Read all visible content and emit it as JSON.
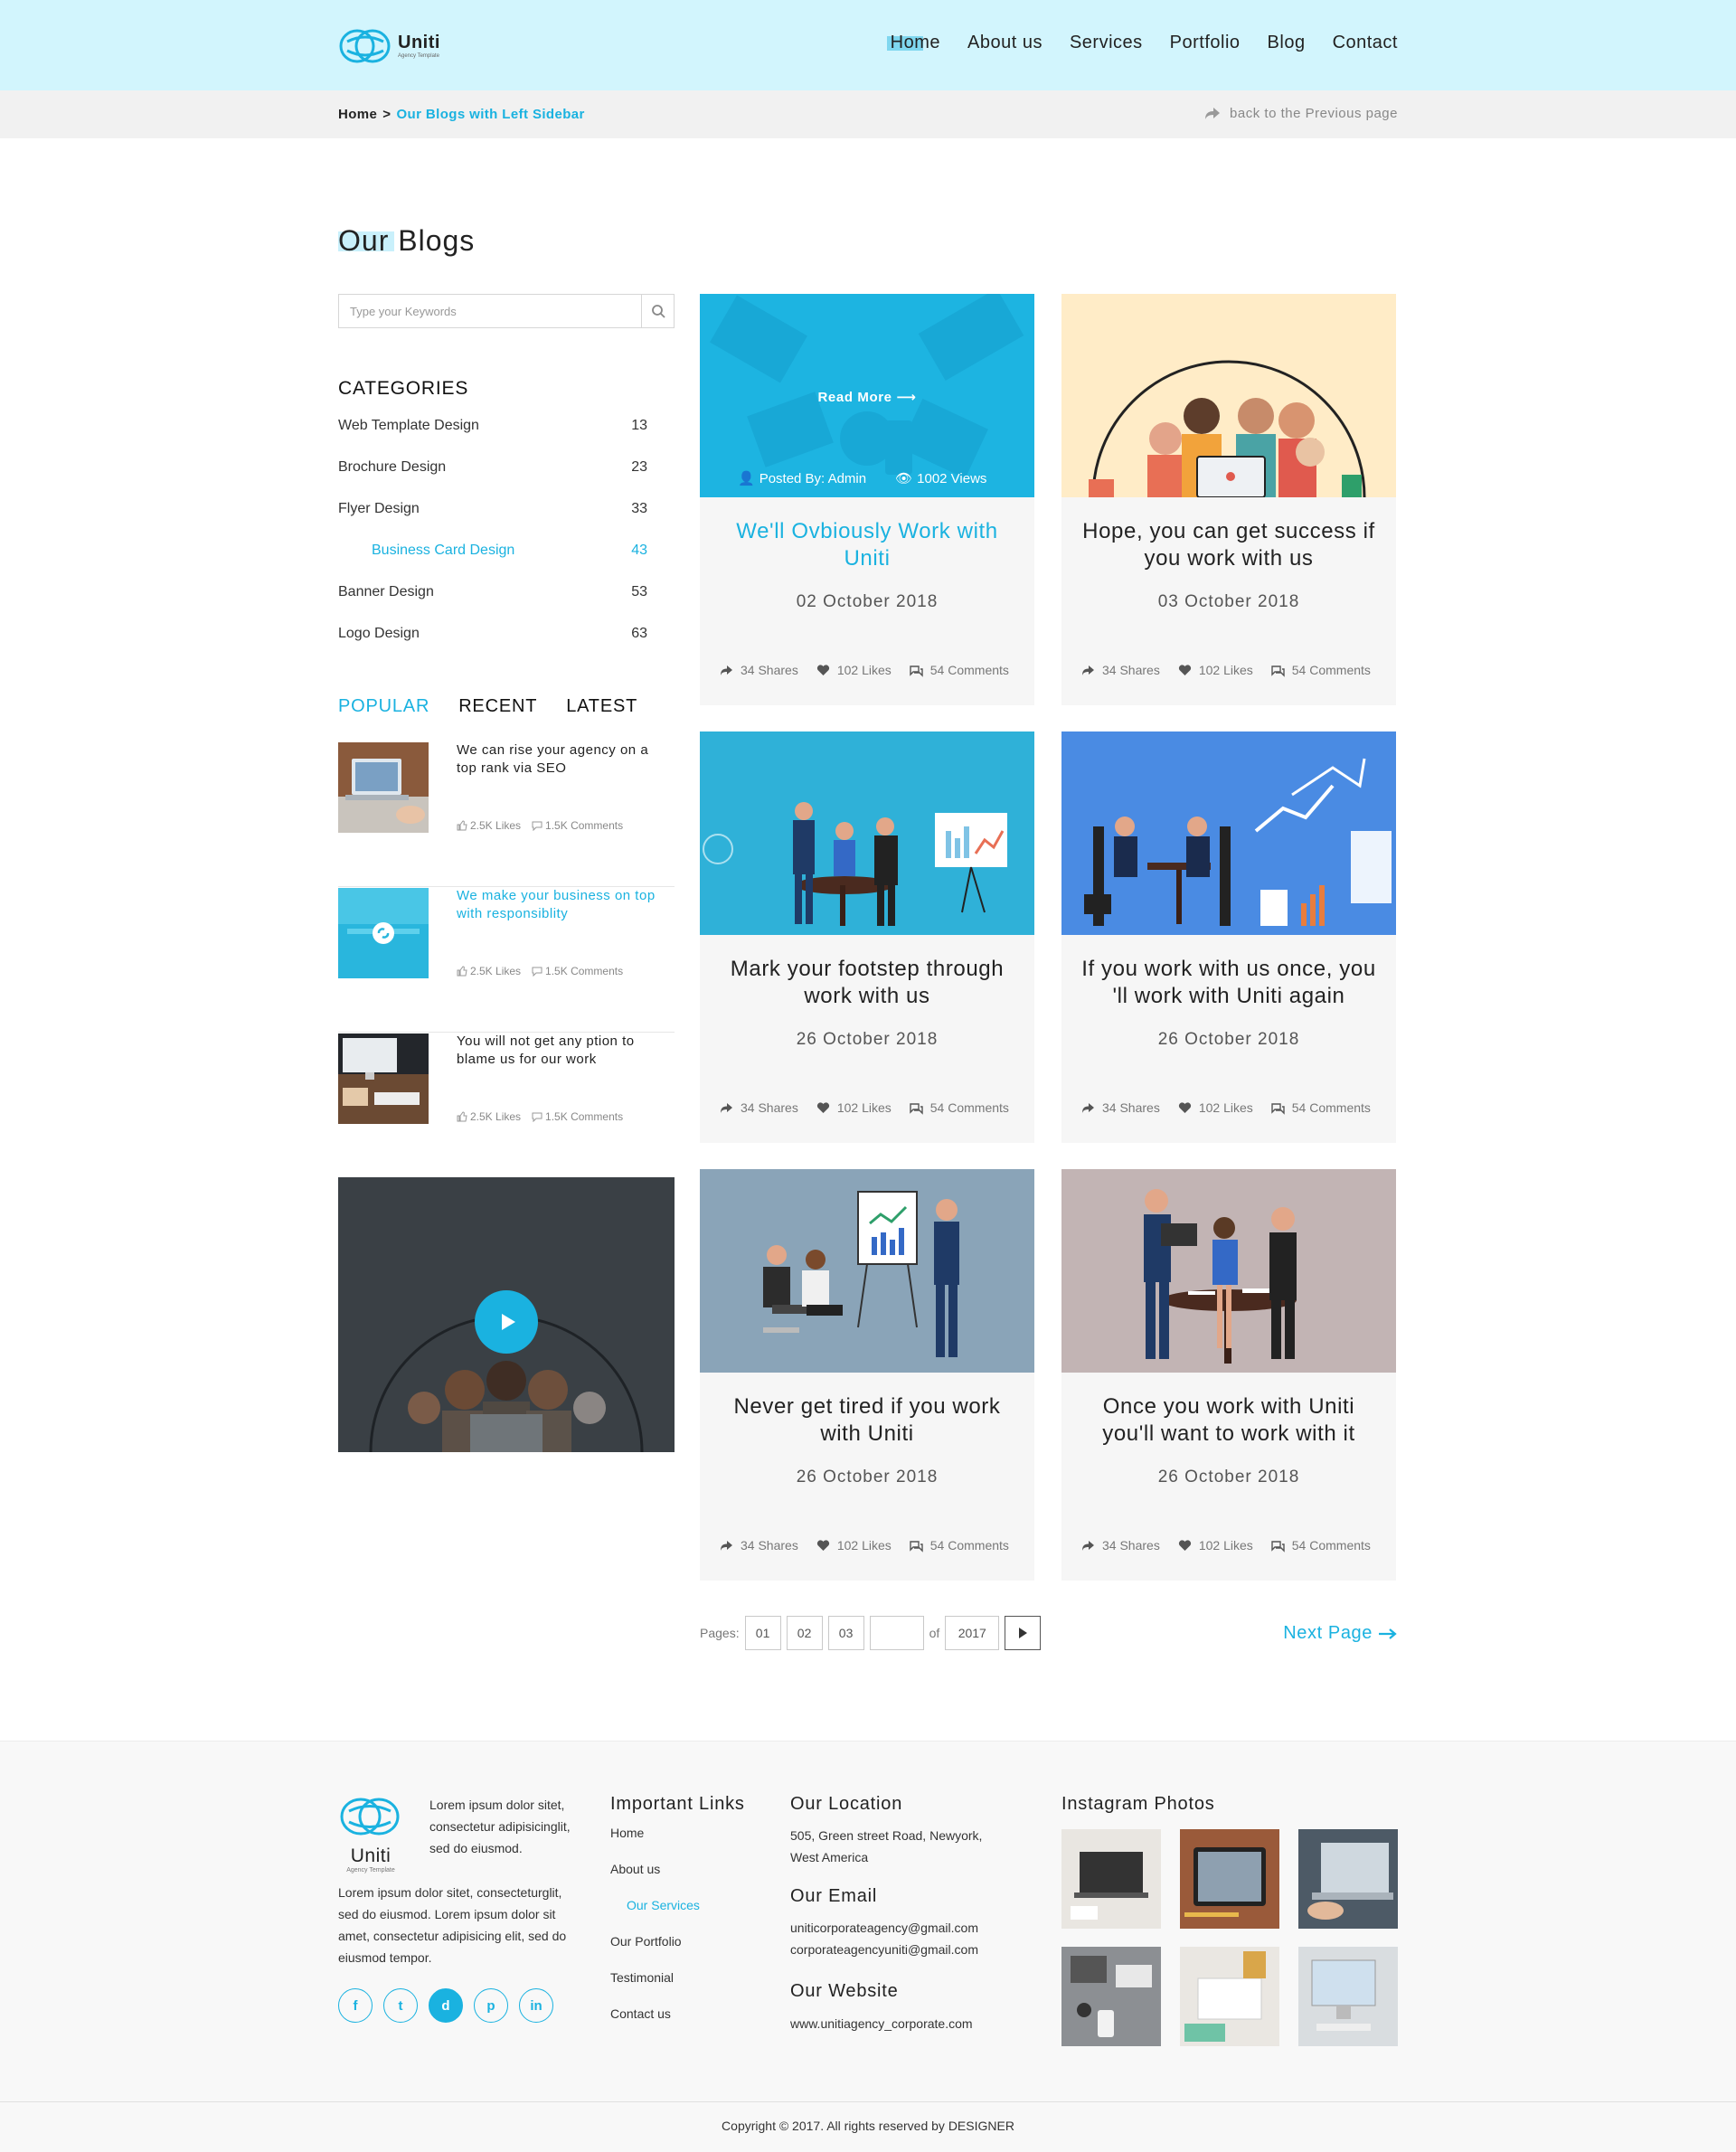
{
  "brand": {
    "name": "Uniti",
    "tagline": "Agency Template"
  },
  "nav": {
    "items": [
      "Home",
      "About us",
      "Services",
      "Portfolio",
      "Blog",
      "Contact"
    ],
    "active": "Home"
  },
  "breadcrumb": {
    "home": "Home",
    "separator": ">",
    "current": "Our Blogs with Left Sidebar",
    "back": "back to the Previous page"
  },
  "page_title": "Our Blogs",
  "search": {
    "placeholder": "Type your Keywords"
  },
  "categories": {
    "title": "CATEGORIES",
    "items": [
      {
        "label": "Web Template Design",
        "count": "13"
      },
      {
        "label": "Brochure Design",
        "count": "23"
      },
      {
        "label": "Flyer Design",
        "count": "33"
      },
      {
        "label": "Business Card Design",
        "count": "43",
        "active": true
      },
      {
        "label": "Banner Design",
        "count": "53"
      },
      {
        "label": "Logo Design",
        "count": "63"
      }
    ]
  },
  "tabs": {
    "items": [
      "POPULAR",
      "RECENT",
      "LATEST"
    ],
    "active": "POPULAR"
  },
  "popular": [
    {
      "title": "We can rise your agency on a top rank via SEO",
      "likes": "2.5K Likes",
      "comments": "1.5K Comments"
    },
    {
      "title": "We make your business on top with responsiblity",
      "likes": "2.5K Likes",
      "comments": "1.5K Comments",
      "active": true
    },
    {
      "title": "You will not get any ption to blame us for our work",
      "likes": "2.5K Likes",
      "comments": "1.5K Comments"
    }
  ],
  "posts": [
    {
      "title": "We'll Ovbiously Work with Uniti",
      "date": "02 October 2018",
      "shares": "34 Shares",
      "likes": "102 Likes",
      "comments": "54 Comments",
      "read_more": "Read More",
      "posted_by": "Posted By: Admin",
      "views": "1002 Views"
    },
    {
      "title": "Hope, you can get success if you work with us",
      "date": "03 October 2018",
      "shares": "34 Shares",
      "likes": "102 Likes",
      "comments": "54 Comments"
    },
    {
      "title": "Mark your footstep through work with us",
      "date": "26 October 2018",
      "shares": "34 Shares",
      "likes": "102 Likes",
      "comments": "54 Comments"
    },
    {
      "title": "If you work with us once, you 'll work with Uniti again",
      "date": "26 October 2018",
      "shares": "34 Shares",
      "likes": "102 Likes",
      "comments": "54 Comments"
    },
    {
      "title": "Never get tired if you work with Uniti",
      "date": "26 October 2018",
      "shares": "34 Shares",
      "likes": "102 Likes",
      "comments": "54 Comments"
    },
    {
      "title": "Once you work with Uniti you'll want to work with it",
      "date": "26 October 2018",
      "shares": "34 Shares",
      "likes": "102 Likes",
      "comments": "54 Comments"
    }
  ],
  "pagination": {
    "label": "Pages:",
    "pages": [
      "01",
      "02",
      "03"
    ],
    "current_input": "",
    "of": "of",
    "total": "2017",
    "next_page": "Next Page"
  },
  "footer": {
    "logo_name": "Uniti",
    "logo_sub": "Agency Template",
    "intro": "Lorem ipsum dolor sitet, consectetur adipisicinglit, sed do eiusmod.",
    "description": "Lorem ipsum dolor sitet, consecteturglit, sed do eiusmod. Lorem ipsum dolor sit amet, consectetur adipisicing elit, sed do eiusmod tempor.",
    "social": [
      "f",
      "t",
      "d",
      "p",
      "in"
    ],
    "links_title": "Important Links",
    "links": [
      "Home",
      "About us",
      "Our Services",
      "Our Portfolio",
      "Testimonial",
      "Contact us"
    ],
    "location_title": "Our Location",
    "location": "505, Green street Road, Newyork, West America",
    "email_title": "Our Email",
    "emails": [
      "uniticorporateagency@gmail.com",
      "corporateagencyuniti@gmail.com"
    ],
    "website_title": "Our Website",
    "website": "www.unitiagency_corporate.com",
    "instagram_title": "Instagram Photos",
    "copyright": "Copyright © 2017. All rights reserved by DESIGNER"
  },
  "colors": {
    "accent": "#1ab2e0",
    "header_bg": "#d2f5fd",
    "card_bg": "#f6f6f6"
  }
}
